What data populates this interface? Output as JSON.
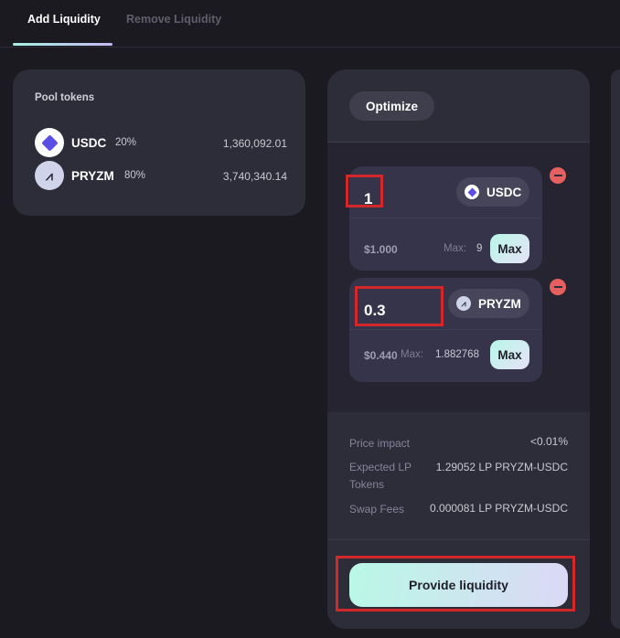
{
  "tabs": [
    {
      "label": "Add Liquidity",
      "active": true
    },
    {
      "label": "Remove Liquidity",
      "active": false
    }
  ],
  "pool": {
    "title": "Pool tokens",
    "tokens": [
      {
        "symbol": "USDC",
        "weight": "20%",
        "amount": "1,360,092.01",
        "icon": "usdc-icon"
      },
      {
        "symbol": "PRYZM",
        "weight": "80%",
        "amount": "3,740,340.14",
        "icon": "pryzm-icon"
      }
    ]
  },
  "form": {
    "optimize_label": "Optimize",
    "inputs": [
      {
        "amount": "1",
        "token": "USDC",
        "price": "$1.000",
        "max_label": "Max:",
        "max_value": "9",
        "max_button": "Max"
      },
      {
        "amount": "0.3",
        "token": "PRYZM",
        "price": "$0.440",
        "max_label": "Max:",
        "max_value": "1.882768",
        "max_button": "Max"
      }
    ]
  },
  "details": {
    "price_impact_label": "Price impact",
    "price_impact_value": "<0.01%",
    "expected_lp_label": "Expected LP Tokens",
    "expected_lp_value": "1.29052 LP PRYZM-USDC",
    "swap_fees_label": "Swap Fees",
    "swap_fees_value": "0.000081 LP PRYZM-USDC"
  },
  "provide_button": "Provide liquidity",
  "colors": {
    "background": "#1b1a21",
    "card": "#2d2c39",
    "accent_gradient_start": "#b9f8e6",
    "accent_gradient_end": "#dcd8f6",
    "remove": "#e85f5f",
    "highlight": "#d3272a"
  }
}
